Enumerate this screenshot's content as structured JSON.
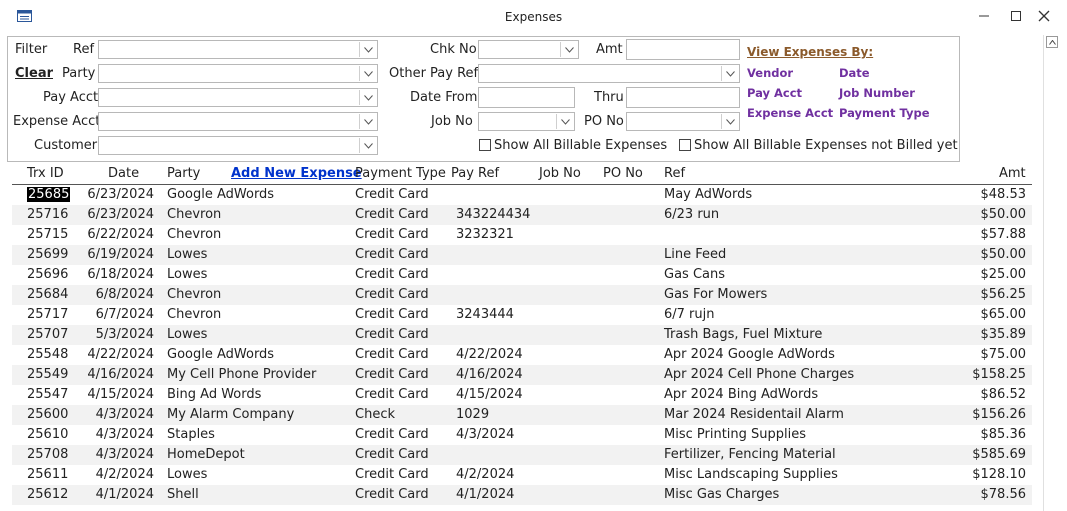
{
  "window": {
    "title": "Expenses"
  },
  "filter": {
    "filter_label": "Filter",
    "clear_label": "Clear",
    "ref_label": "Ref",
    "party_label": "Party",
    "pay_acct_label": "Pay Acct",
    "expense_acct_label": "Expense Acct",
    "customer_label": "Customer",
    "chk_no_label": "Chk No",
    "amt_label": "Amt",
    "other_pay_ref_label": "Other Pay Ref",
    "date_from_label": "Date From",
    "thru_label": "Thru",
    "job_no_label": "Job No",
    "po_no_label": "PO No",
    "show_billable_label": "Show All Billable Expenses",
    "show_not_billed_label": "Show All Billable Expenses not Billed yet"
  },
  "view_by": {
    "title": "View Expenses By:",
    "vendor": "Vendor",
    "date": "Date",
    "pay_acct": "Pay Acct",
    "job_number": "Job Number",
    "expense_acct": "Expense Acct",
    "payment_type": "Payment Type"
  },
  "table": {
    "headers": {
      "trx_id": "Trx ID",
      "date": "Date",
      "party": "Party",
      "add_new": "Add New Expense",
      "payment_type": "Payment Type",
      "pay_ref": "Pay Ref",
      "job_no": "Job No",
      "po_no": "PO No",
      "ref": "Ref",
      "amt": "Amt"
    },
    "rows": [
      {
        "id": "25685",
        "date": "6/23/2024",
        "party": "Google AdWords",
        "type": "Credit Card",
        "payref": "",
        "ref": "May AdWords",
        "amt": "$48.53"
      },
      {
        "id": "25716",
        "date": "6/23/2024",
        "party": "Chevron",
        "type": "Credit Card",
        "payref": "343224434",
        "ref": "6/23 run",
        "amt": "$50.00"
      },
      {
        "id": "25715",
        "date": "6/22/2024",
        "party": "Chevron",
        "type": "Credit Card",
        "payref": "3232321",
        "ref": "",
        "amt": "$57.88"
      },
      {
        "id": "25699",
        "date": "6/19/2024",
        "party": "Lowes",
        "type": "Credit Card",
        "payref": "",
        "ref": "Line Feed",
        "amt": "$50.00"
      },
      {
        "id": "25696",
        "date": "6/18/2024",
        "party": "Lowes",
        "type": "Credit Card",
        "payref": "",
        "ref": "Gas Cans",
        "amt": "$25.00"
      },
      {
        "id": "25684",
        "date": "6/8/2024",
        "party": "Chevron",
        "type": "Credit Card",
        "payref": "",
        "ref": "Gas For Mowers",
        "amt": "$56.25"
      },
      {
        "id": "25717",
        "date": "6/7/2024",
        "party": "Chevron",
        "type": "Credit Card",
        "payref": "3243444",
        "ref": "6/7 rujn",
        "amt": "$65.00"
      },
      {
        "id": "25707",
        "date": "5/3/2024",
        "party": "Lowes",
        "type": "Credit Card",
        "payref": "",
        "ref": "Trash Bags, Fuel Mixture",
        "amt": "$35.89"
      },
      {
        "id": "25548",
        "date": "4/22/2024",
        "party": "Google AdWords",
        "type": "Credit Card",
        "payref": "4/22/2024",
        "ref": "Apr 2024 Google AdWords",
        "amt": "$75.00"
      },
      {
        "id": "25549",
        "date": "4/16/2024",
        "party": "My Cell Phone Provider",
        "type": "Credit Card",
        "payref": "4/16/2024",
        "ref": "Apr 2024 Cell Phone Charges",
        "amt": "$158.25"
      },
      {
        "id": "25547",
        "date": "4/15/2024",
        "party": "Bing Ad Words",
        "type": "Credit Card",
        "payref": "4/15/2024",
        "ref": "Apr 2024 Bing AdWords",
        "amt": "$86.52"
      },
      {
        "id": "25600",
        "date": "4/3/2024",
        "party": "My Alarm Company",
        "type": "Check",
        "payref": "1029",
        "ref": "Mar 2024 Residentail Alarm",
        "amt": "$156.26"
      },
      {
        "id": "25610",
        "date": "4/3/2024",
        "party": "Staples",
        "type": "Credit Card",
        "payref": "4/3/2024",
        "ref": "Misc Printing Supplies",
        "amt": "$85.36"
      },
      {
        "id": "25708",
        "date": "4/3/2024",
        "party": "HomeDepot",
        "type": "Credit Card",
        "payref": "",
        "ref": "Fertilizer, Fencing Material",
        "amt": "$585.69"
      },
      {
        "id": "25611",
        "date": "4/2/2024",
        "party": "Lowes",
        "type": "Credit Card",
        "payref": "4/2/2024",
        "ref": "Misc Landscaping Supplies",
        "amt": "$128.10"
      },
      {
        "id": "25612",
        "date": "4/1/2024",
        "party": "Shell",
        "type": "Credit Card",
        "payref": "4/1/2024",
        "ref": "Misc Gas Charges",
        "amt": "$78.56"
      }
    ]
  },
  "colors": {
    "accent_link": "#0033cc",
    "view_by": "#7030a0",
    "view_by_title": "#8b5a2b"
  }
}
